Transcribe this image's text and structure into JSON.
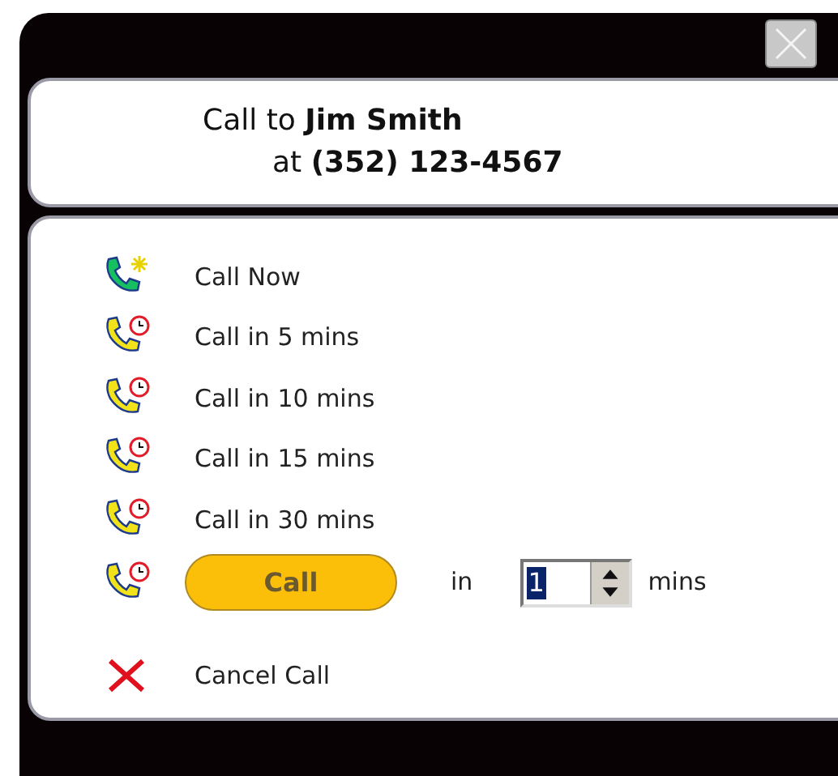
{
  "header": {
    "line_1": "Call to **Jim Smith**",
    "line_2": "at **(352) 123-4567**"
  },
  "options": [
    {
      "kind": "now",
      "label": "Call Now"
    },
    {
      "kind": "later",
      "label": "Call in 5 mins"
    },
    {
      "kind": "later",
      "label": "Call in 10 mins"
    },
    {
      "kind": "later",
      "label": "Call in 15 mins"
    },
    {
      "kind": "later",
      "label": "Call in 30 mins"
    }
  ],
  "custom": {
    "button": "Call",
    "in_label": "in",
    "value": "1",
    "unit": "mins"
  },
  "cancel": {
    "label": "Cancel Call"
  }
}
